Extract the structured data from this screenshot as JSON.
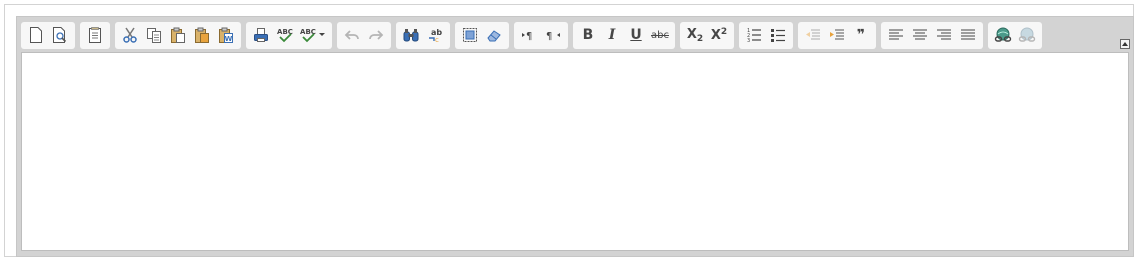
{
  "editor": {
    "content_text": "",
    "toolbar": {
      "groups": [
        {
          "name": "document",
          "buttons": [
            "new-page-icon",
            "preview-icon"
          ]
        },
        {
          "name": "templates",
          "buttons": [
            "templates-icon"
          ]
        },
        {
          "name": "clipboard",
          "buttons": [
            "cut-icon",
            "copy-icon",
            "paste-icon",
            "paste-text-icon",
            "paste-from-word-icon"
          ]
        },
        {
          "name": "editing",
          "buttons": [
            "print-icon",
            "spellcheck-icon",
            "spellcheck-as-you-type-icon"
          ]
        },
        {
          "name": "undo",
          "buttons": [
            "undo-icon",
            "redo-icon"
          ]
        },
        {
          "name": "find",
          "buttons": [
            "find-icon",
            "replace-icon"
          ]
        },
        {
          "name": "selection",
          "buttons": [
            "select-all-icon",
            "remove-format-icon"
          ]
        },
        {
          "name": "bidi",
          "buttons": [
            "text-direction-ltr-icon",
            "text-direction-rtl-icon"
          ]
        },
        {
          "name": "basicstyles",
          "buttons": [
            "bold",
            "italic",
            "underline",
            "strikethrough"
          ]
        },
        {
          "name": "scripts",
          "buttons": [
            "subscript",
            "superscript"
          ]
        },
        {
          "name": "lists",
          "buttons": [
            "numbered-list-icon",
            "bulleted-list-icon"
          ]
        },
        {
          "name": "indent",
          "buttons": [
            "outdent-icon",
            "indent-icon",
            "blockquote-icon"
          ]
        },
        {
          "name": "align",
          "buttons": [
            "align-left-icon",
            "align-center-icon",
            "align-right-icon",
            "align-justify-icon"
          ]
        },
        {
          "name": "links",
          "buttons": [
            "link-icon",
            "unlink-icon"
          ]
        }
      ]
    },
    "labels": {
      "bold": "B",
      "italic": "I",
      "underline": "U",
      "strike": "abc",
      "sub_base": "X",
      "sub_index": "2",
      "sup_base": "X",
      "sup_index": "2",
      "spell": "ABC",
      "spell2": "ABC",
      "quote": "❞"
    },
    "colors": {
      "toolbar_bg": "#d3d3d3",
      "group_bg": "#f7f7f7",
      "icon": "#474747",
      "accent_blue": "#3a6fb5",
      "accent_orange": "#e8a33d"
    }
  }
}
